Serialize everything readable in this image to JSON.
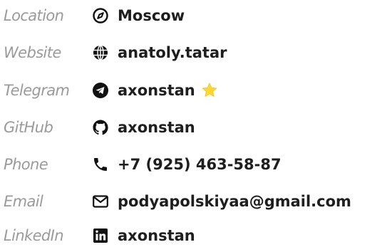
{
  "contacts": [
    {
      "label": "Location",
      "icon": "compass-icon",
      "value": "Moscow"
    },
    {
      "label": "Website",
      "icon": "globe-icon",
      "value": "anatoly.tatar"
    },
    {
      "label": "Telegram",
      "icon": "telegram-icon",
      "value": "axonstan",
      "badge_icon": "star-icon"
    },
    {
      "label": "GitHub",
      "icon": "github-icon",
      "value": "axonstan"
    },
    {
      "label": "Phone",
      "icon": "phone-icon",
      "value": "+7 (925) 463-58-87"
    },
    {
      "label": "Email",
      "icon": "envelope-icon",
      "value": "podyapolskiyaa@gmail.com"
    },
    {
      "label": "LinkedIn",
      "icon": "linkedin-icon",
      "value": "axonstan"
    }
  ],
  "colors": {
    "label": "#9a9a9a",
    "value": "#1e1e1e",
    "icon": "#111111",
    "star": "#fdd835"
  }
}
